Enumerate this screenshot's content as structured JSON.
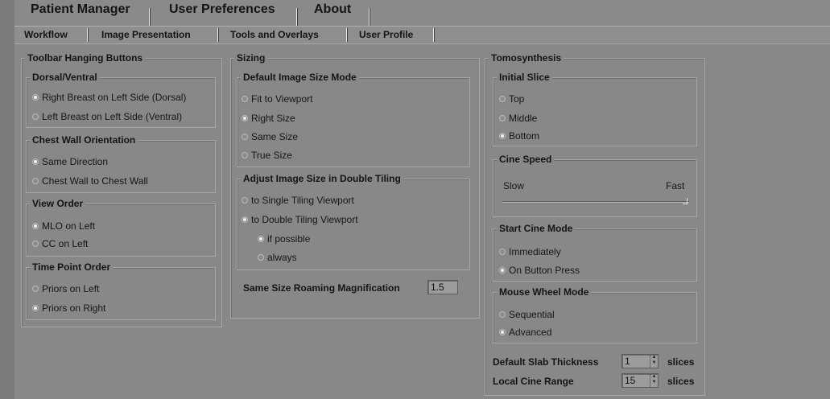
{
  "main_tabs": [
    "Patient Manager",
    "User Preferences",
    "About"
  ],
  "sub_tabs": [
    "Workflow",
    "Image Presentation",
    "Tools and Overlays",
    "User Profile"
  ],
  "toolbar": {
    "title": "Toolbar Hanging Buttons",
    "dorsal": {
      "title": "Dorsal/Ventral",
      "options": [
        "Right Breast on Left Side (Dorsal)",
        "Left Breast on Left Side (Ventral)"
      ],
      "selected": 0
    },
    "chest": {
      "title": "Chest Wall Orientation",
      "options": [
        "Same Direction",
        "Chest Wall to Chest Wall"
      ],
      "selected": 0
    },
    "view": {
      "title": "View Order",
      "options": [
        "MLO on Left",
        "CC on Left"
      ],
      "selected": 0
    },
    "time": {
      "title": "Time Point Order",
      "options": [
        "Priors on Left",
        "Priors on Right"
      ],
      "selected": 1
    }
  },
  "sizing": {
    "title": "Sizing",
    "default_mode": {
      "title": "Default Image Size Mode",
      "options": [
        "Fit to Viewport",
        "Right Size",
        "Same Size",
        "True Size"
      ],
      "selected": 1
    },
    "double_tiling": {
      "title": "Adjust Image Size in Double Tiling",
      "options": [
        "to Single Tiling Viewport",
        "to Double Tiling Viewport"
      ],
      "selected": 1,
      "sub_options": [
        "if possible",
        "always"
      ],
      "sub_selected": 0
    },
    "roaming_label": "Same Size Roaming Magnification",
    "roaming_value": "1.5"
  },
  "tomo": {
    "title": "Tomosynthesis",
    "initial_slice": {
      "title": "Initial Slice",
      "options": [
        "Top",
        "Middle",
        "Bottom"
      ],
      "selected": 2
    },
    "cine_speed": {
      "title": "Cine Speed",
      "slow_label": "Slow",
      "fast_label": "Fast",
      "value_fraction": 1.0
    },
    "start_cine": {
      "title": "Start Cine Mode",
      "options": [
        "Immediately",
        "On Button Press"
      ],
      "selected": 1
    },
    "mouse_wheel": {
      "title": "Mouse Wheel Mode",
      "options": [
        "Sequential",
        "Advanced"
      ],
      "selected": 1
    },
    "slab_label": "Default Slab Thickness",
    "slab_value": "1",
    "slab_unit": "slices",
    "cine_range_label": "Local Cine Range",
    "cine_range_value": "15",
    "cine_range_unit": "slices"
  }
}
